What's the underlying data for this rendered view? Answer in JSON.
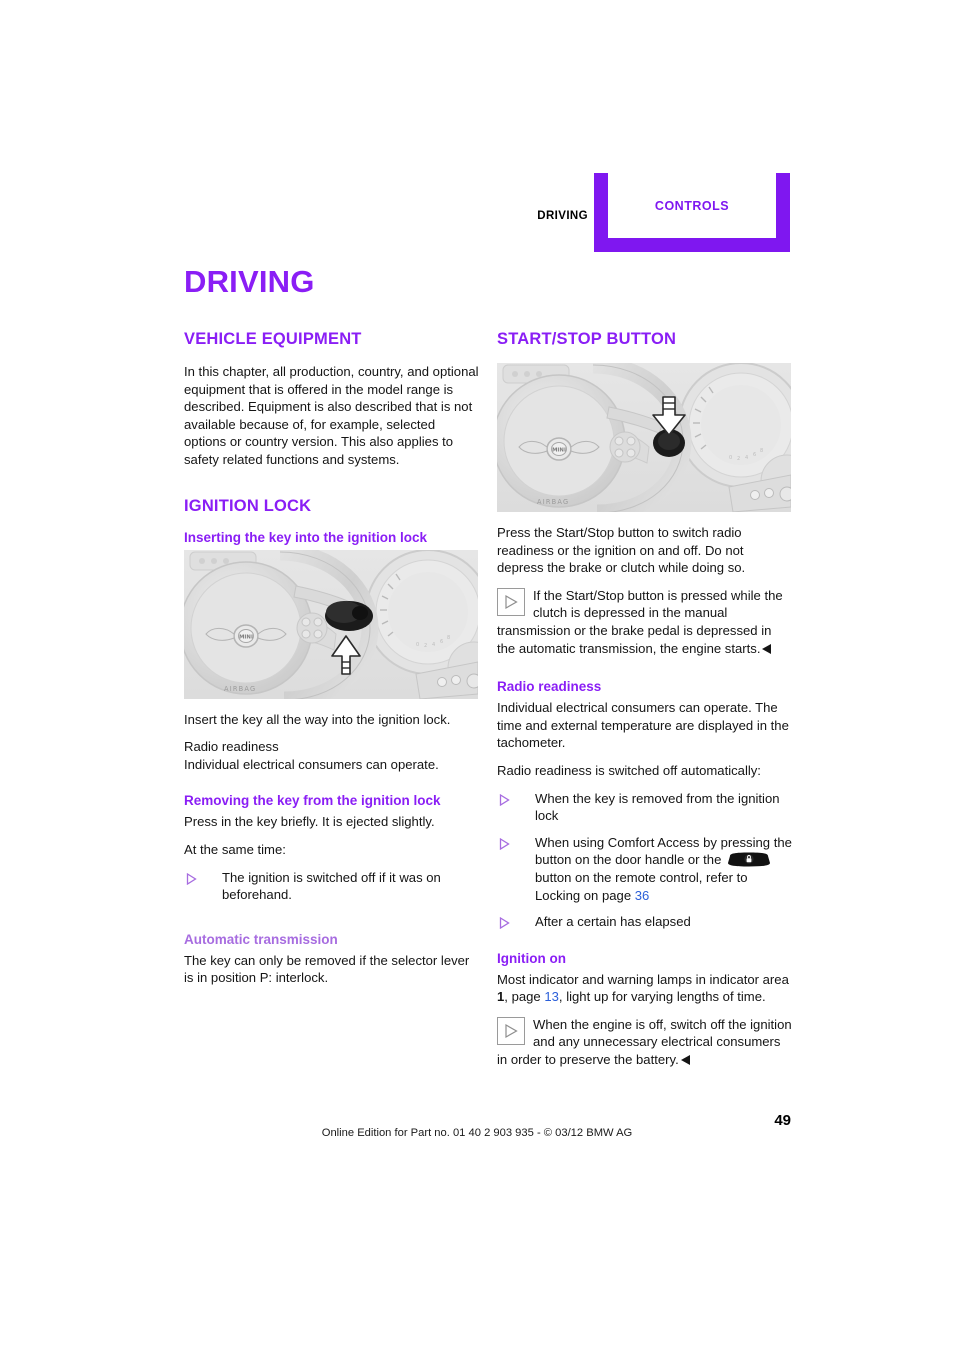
{
  "header": {
    "left_label": "DRIVING",
    "tab_label": "CONTROLS",
    "accent_color": "#7f17f0"
  },
  "chapter": {
    "title": "DRIVING"
  },
  "left_column": {
    "vehicle_equipment": {
      "heading": "VEHICLE EQUIPMENT",
      "paragraph": "In this chapter, all production, country, and optional equipment that is offered in the model range is described. Equipment is also described that is not available because of, for example, selected options or country version. This also applies to safety related functions and systems."
    },
    "ignition_lock": {
      "heading": "IGNITION LOCK",
      "inserting": {
        "heading": "Inserting the key into the ignition lock",
        "figure_name": "steering-wheel-ignition-lock-insert",
        "paragraph_1": "Insert the key all the way into the ignition lock.",
        "paragraph_2_line1": "Radio readiness",
        "paragraph_2_line2": "Individual electrical consumers can operate."
      },
      "removing": {
        "heading": "Removing the key from the ignition lock",
        "paragraph_1": "Press in the key briefly. It is ejected slightly.",
        "paragraph_2": "At the same time:",
        "bullets": [
          "The ignition is switched off if it was on beforehand."
        ]
      },
      "automatic_transmission": {
        "heading": "Automatic transmission",
        "paragraph": "The key can only be removed if the selector lever is in position P: interlock."
      }
    }
  },
  "right_column": {
    "start_stop": {
      "heading": "START/STOP BUTTON",
      "figure_name": "steering-wheel-start-stop-button",
      "paragraph_1": "Press the Start/Stop button to switch radio readiness or the ignition on and off. Do not depress the brake or clutch while doing so.",
      "note": {
        "icon_name": "note-triangle-icon",
        "text": "If the Start/Stop button is pressed while the clutch is depressed in the manual transmission or the brake pedal is depressed in the automatic transmission, the engine starts."
      }
    },
    "radio_readiness": {
      "heading": "Radio readiness",
      "paragraph_1": "Individual electrical consumers can operate. The time and external temperature are displayed in the tachometer.",
      "paragraph_2": "Radio readiness is switched off automatically:",
      "bullets": [
        {
          "text": "When the key is removed from the ignition lock"
        },
        {
          "text_before": "When using Comfort Access by pressing the button on the door handle or the",
          "icon_name": "remote-lock-button-icon",
          "text_after": "button on the remote control, refer to Locking on page",
          "page_ref": "36"
        },
        {
          "text": "After a certain has elapsed"
        }
      ]
    },
    "ignition_on": {
      "heading": "Ignition on",
      "paragraph_before": "Most indicator and warning lamps in indicator area",
      "area_number": "1",
      "paragraph_middle": ", page",
      "page_ref": "13",
      "paragraph_after": ", light up for varying lengths of time.",
      "note": {
        "icon_name": "note-triangle-icon",
        "text": "When the engine is off, switch off the ignition and any unnecessary electrical consumers in order to preserve the battery."
      }
    }
  },
  "footer": {
    "edition_text": "Online Edition for Part no. 01 40 2 903 935 - © 03/12 BMW AG",
    "page_number": "49"
  },
  "colors": {
    "heading_purple": "#8a1ef5",
    "light_purple": "#a76ce0",
    "link_blue": "#2b5fd9",
    "tab_purple": "#7f17f0"
  }
}
